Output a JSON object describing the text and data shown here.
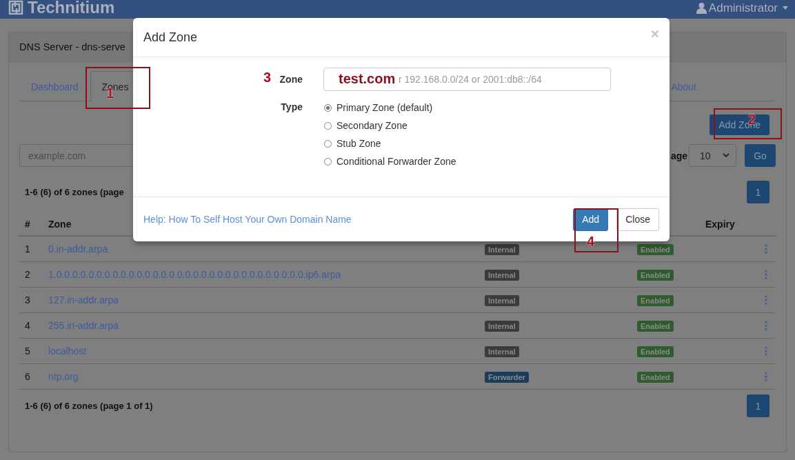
{
  "navbar": {
    "brand": "Technitium",
    "user": "Administrator"
  },
  "panel": {
    "title": "DNS Server - dns-serve"
  },
  "tabs": [
    {
      "label": "Dashboard",
      "selected": false
    },
    {
      "label": "Zones",
      "selected": true
    },
    {
      "label": "About",
      "selected": false
    }
  ],
  "toolbar": {
    "add_button": "Add Zone",
    "search_placeholder": "example.com",
    "page_label": "age",
    "page_size": "10",
    "go_button": "Go"
  },
  "summary_top": "1-6 (6) of 6 zones (page",
  "pagination_top": [
    {
      "label": "1",
      "selected": true
    }
  ],
  "table": {
    "columns": [
      "#",
      "Zone",
      "Expiry"
    ],
    "rows": [
      {
        "index": "1",
        "zone": "0.in-addr.arpa",
        "type": {
          "label": "Internal",
          "color": "#3b3b3b"
        },
        "status": {
          "label": "Enabled",
          "color": "#2e5c2e"
        }
      },
      {
        "index": "2",
        "zone": "1.0.0.0.0.0.0.0.0.0.0.0.0.0.0.0.0.0.0.0.0.0.0.0.0.0.0.0.0.0.0.0.ip6.arpa",
        "type": {
          "label": "Internal",
          "color": "#3b3b3b"
        },
        "status": {
          "label": "Enabled",
          "color": "#2e5c2e"
        }
      },
      {
        "index": "3",
        "zone": "127.in-addr.arpa",
        "type": {
          "label": "Internal",
          "color": "#3b3b3b"
        },
        "status": {
          "label": "Enabled",
          "color": "#2e5c2e"
        }
      },
      {
        "index": "4",
        "zone": "255.in-addr.arpa",
        "type": {
          "label": "Internal",
          "color": "#3b3b3b"
        },
        "status": {
          "label": "Enabled",
          "color": "#2e5c2e"
        }
      },
      {
        "index": "5",
        "zone": "localhost",
        "type": {
          "label": "Internal",
          "color": "#3b3b3b"
        },
        "status": {
          "label": "Enabled",
          "color": "#2e5c2e"
        }
      },
      {
        "index": "6",
        "zone": "ntp.org",
        "type": {
          "label": "Forwarder",
          "color": "#1a3d5c"
        },
        "status": {
          "label": "Enabled",
          "color": "#2e5c2e"
        }
      }
    ]
  },
  "summary_bottom": "1-6 (6) of 6 zones (page 1 of 1)",
  "pagination_bottom": [
    {
      "label": "1",
      "selected": true
    }
  ],
  "dialog": {
    "title": "Add Zone",
    "close": "×",
    "zone_label": "Zone",
    "zone_placeholder": "r 192.168.0.0/24 or 2001:db8::/64",
    "type_label": "Type",
    "types": [
      {
        "label": "Primary Zone (default)",
        "selected": true
      },
      {
        "label": "Secondary Zone",
        "selected": false
      },
      {
        "label": "Stub Zone",
        "selected": false
      },
      {
        "label": "Conditional Forwarder Zone",
        "selected": false
      }
    ],
    "help_link": "Help: How To Self Host Your Own Domain Name",
    "buttons": [
      {
        "label": "Add",
        "kind": "primary"
      },
      {
        "label": "Close",
        "kind": "default"
      }
    ]
  },
  "annotations": [
    {
      "kind": "box",
      "number": "1"
    },
    {
      "kind": "box",
      "number": "2"
    },
    {
      "kind": "mark",
      "number": "3"
    },
    {
      "kind": "box",
      "number": "4"
    },
    {
      "kind": "text",
      "text": "test.com"
    }
  ]
}
